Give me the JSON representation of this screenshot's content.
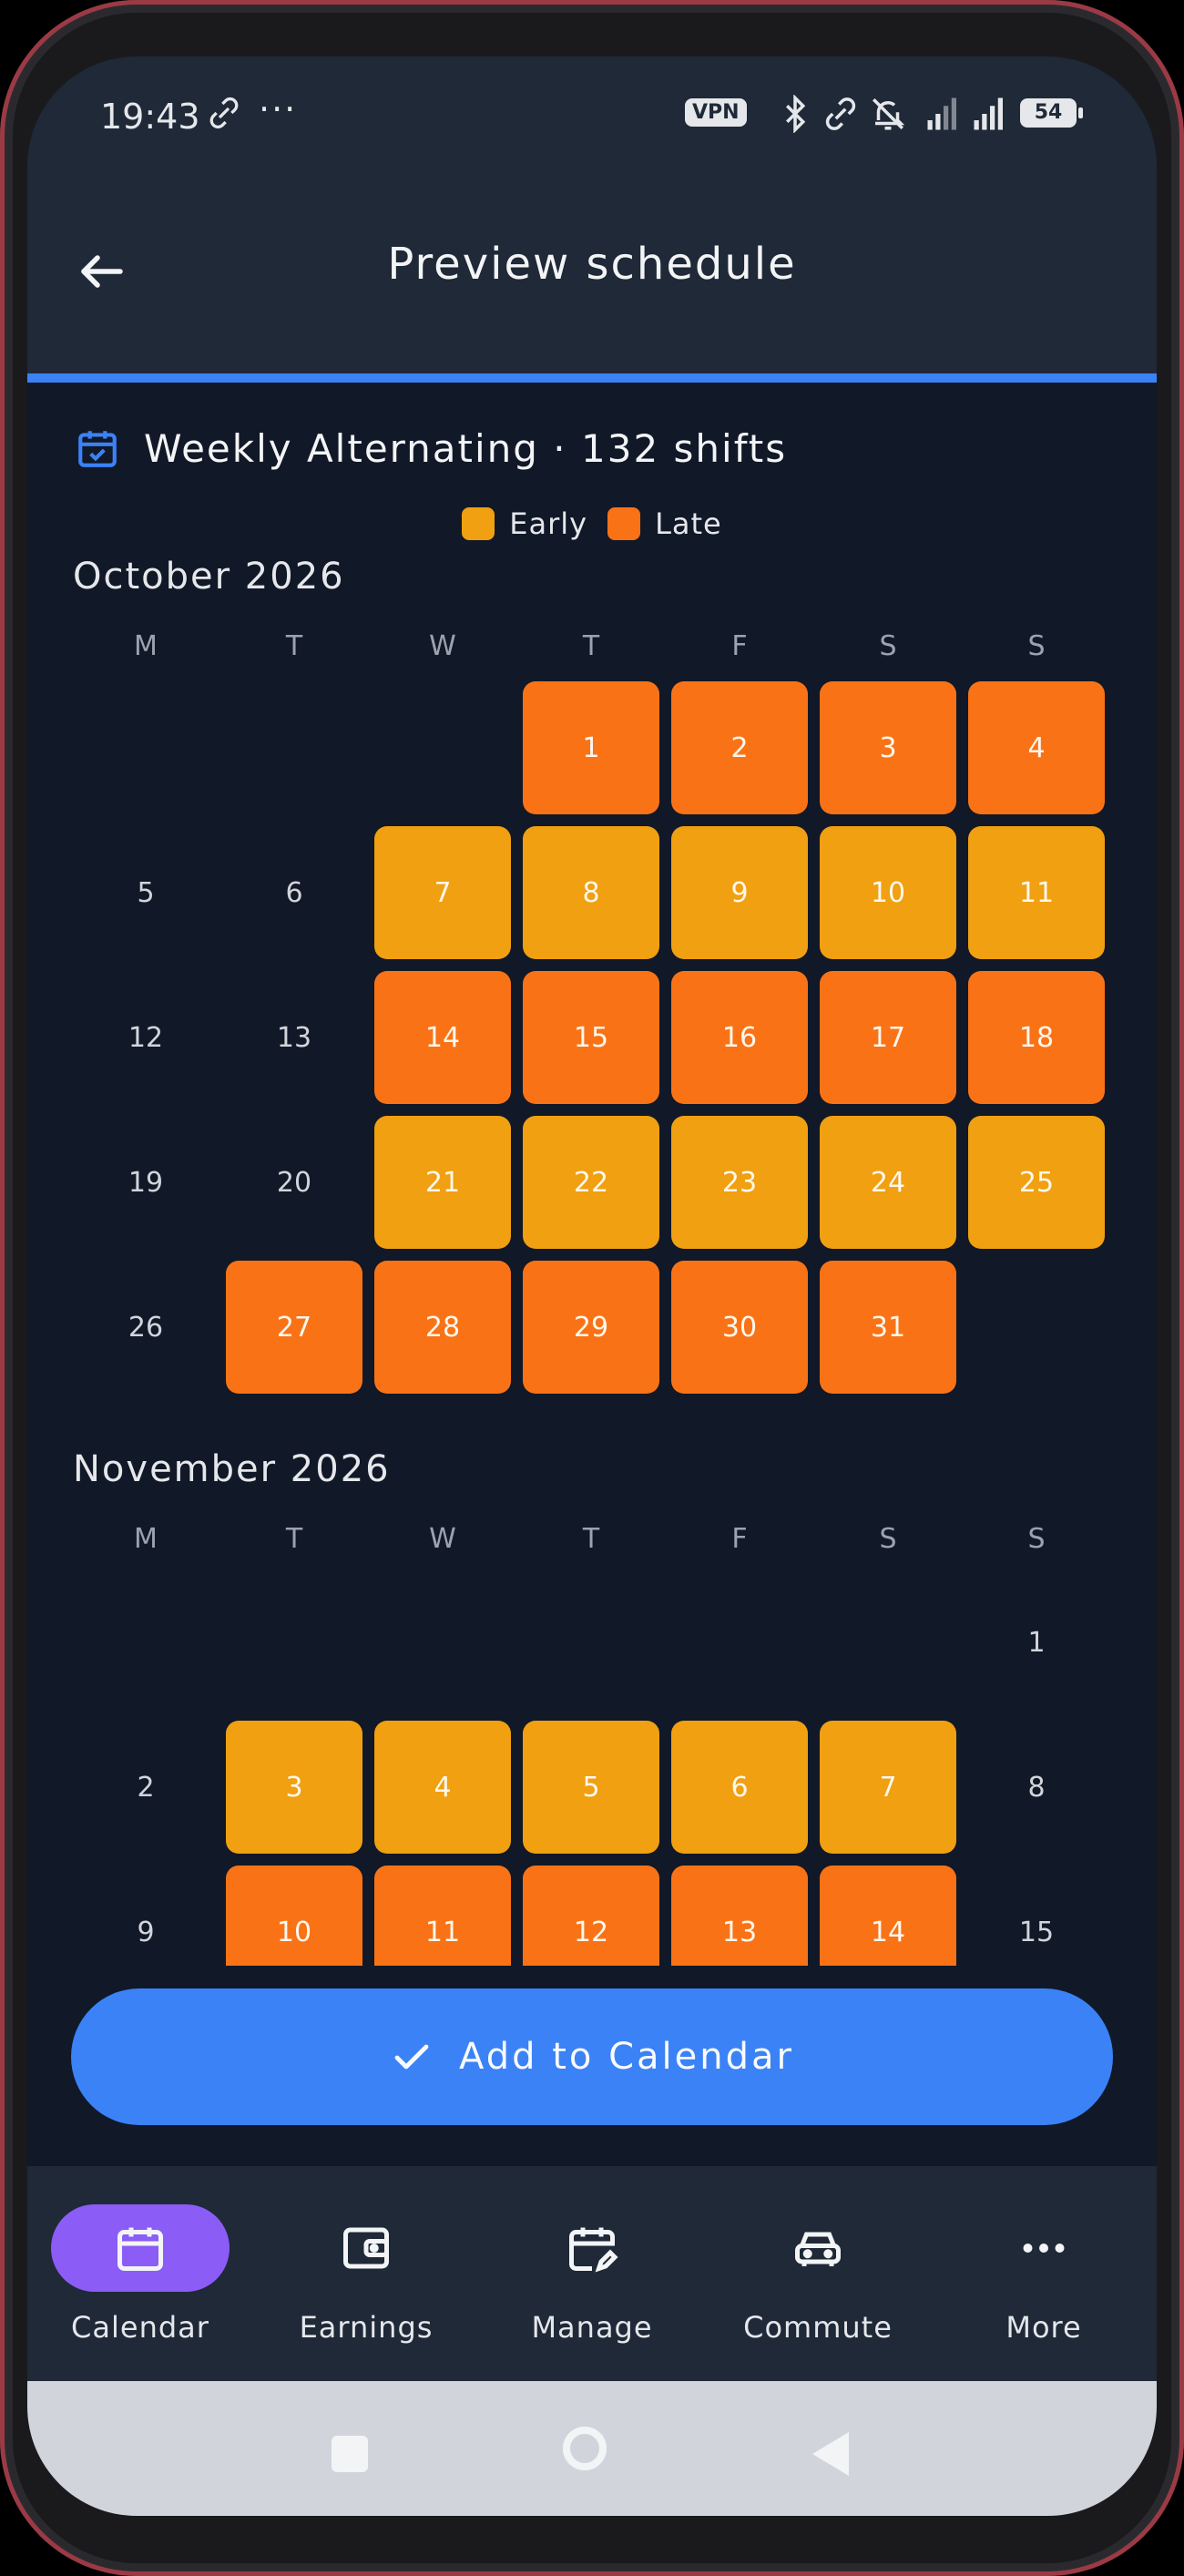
{
  "status": {
    "time": "19:43",
    "dots": "···",
    "vpn": "VPN",
    "battery": "54"
  },
  "header": {
    "title": "Preview schedule",
    "back_icon": "arrow-left-icon"
  },
  "summary": {
    "text": "Weekly Alternating · 132 shifts",
    "icon": "calendar-check-icon"
  },
  "legend": [
    {
      "label": "Early",
      "color": "#f0a010"
    },
    {
      "label": "Late",
      "color": "#f97316"
    }
  ],
  "weekdays": [
    "M",
    "T",
    "W",
    "T",
    "F",
    "S",
    "S"
  ],
  "months": [
    {
      "title": "October 2026"
    },
    {
      "title": "November 2026"
    }
  ],
  "october_days": [
    "1",
    "2",
    "3",
    "4",
    "5",
    "6",
    "7",
    "8",
    "9",
    "10",
    "11",
    "12",
    "13",
    "14",
    "15",
    "16",
    "17",
    "18",
    "19",
    "20",
    "21",
    "22",
    "23",
    "24",
    "25",
    "26",
    "27",
    "28",
    "29",
    "30",
    "31"
  ],
  "november_days": [
    "1",
    "2",
    "3",
    "4",
    "5",
    "6",
    "7",
    "8",
    "9",
    "10",
    "11",
    "12",
    "13",
    "14",
    "15"
  ],
  "cta": {
    "label": "Add to Calendar"
  },
  "nav": [
    {
      "label": "Calendar",
      "icon": "calendar-icon",
      "active": true
    },
    {
      "label": "Earnings",
      "icon": "wallet-icon"
    },
    {
      "label": "Manage",
      "icon": "calendar-edit-icon"
    },
    {
      "label": "Commute",
      "icon": "car-icon"
    },
    {
      "label": "More",
      "icon": "more-horizontal-icon"
    }
  ],
  "colors": {
    "accent": "#3b82f6",
    "early": "#f0a010",
    "late": "#f97316",
    "nav_active": "#8b5cf6"
  }
}
